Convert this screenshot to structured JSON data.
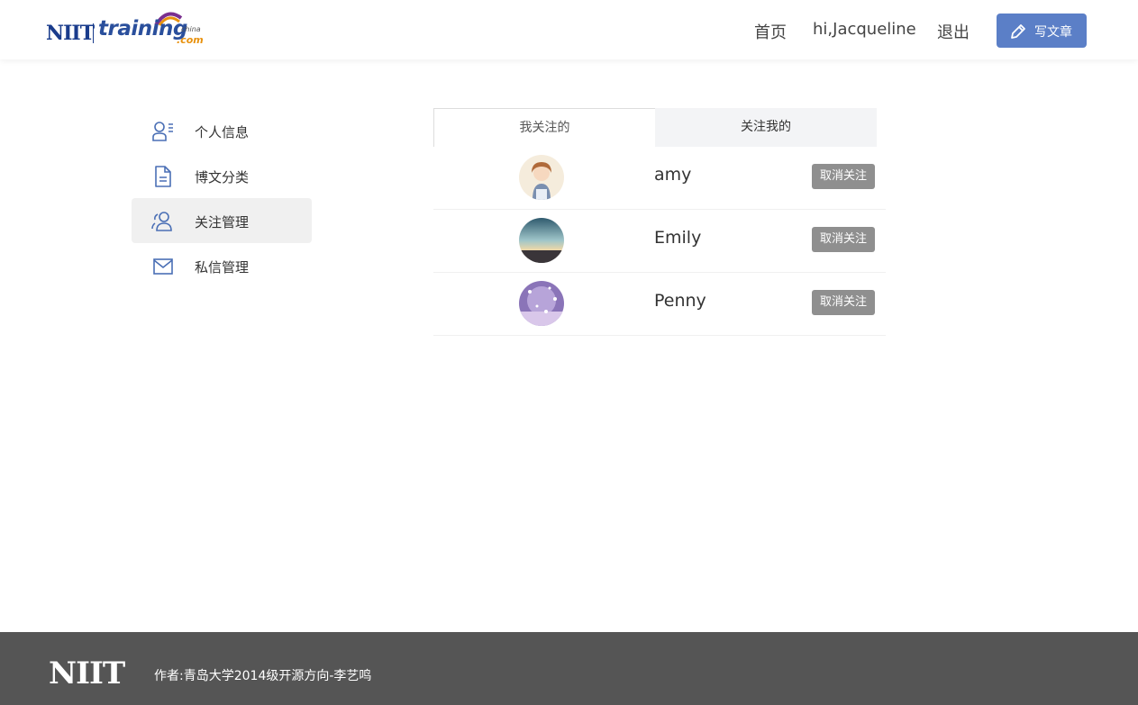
{
  "header": {
    "logo": {
      "brand_a": "NIIT",
      "brand_b": "training",
      "brand_c": "china",
      "brand_d": ".com"
    },
    "nav": {
      "home": "首页",
      "user": "hi,Jacqueline",
      "logout": "退出"
    },
    "write_button": "写文章"
  },
  "sidebar": {
    "items": [
      {
        "label": "个人信息",
        "icon": "user-info-icon",
        "active": false
      },
      {
        "label": "博文分类",
        "icon": "document-icon",
        "active": false
      },
      {
        "label": "关注管理",
        "icon": "users-icon",
        "active": true
      },
      {
        "label": "私信管理",
        "icon": "mail-icon",
        "active": false
      }
    ]
  },
  "tabs": [
    {
      "label": "我关注的",
      "active": true
    },
    {
      "label": "关注我的",
      "active": false
    }
  ],
  "follow_list": [
    {
      "name": "amy",
      "action": "取消关注"
    },
    {
      "name": "Emily",
      "action": "取消关注"
    },
    {
      "name": "Penny",
      "action": "取消关注"
    }
  ],
  "footer": {
    "logo": "NIIT",
    "credit": "作者:青岛大学2014级开源方向-李艺鸣"
  },
  "colors": {
    "accent": "#5b7fc7",
    "footer_bg": "#555555",
    "unfollow_bg": "#8f8f8f"
  }
}
